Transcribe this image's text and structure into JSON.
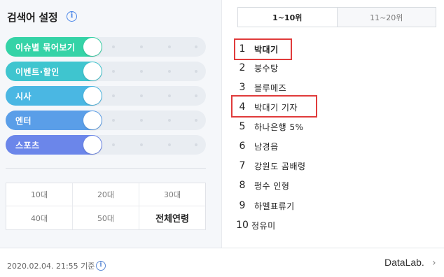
{
  "settings": {
    "title": "검색어 설정",
    "info_icon": "i"
  },
  "toggles": [
    {
      "label": "이슈별 묶어보기",
      "color": "#35d3a7"
    },
    {
      "label": "이벤트·할인",
      "color": "#3fc5cf"
    },
    {
      "label": "시사",
      "color": "#4ab7e3"
    },
    {
      "label": "엔터",
      "color": "#5a9ee8"
    },
    {
      "label": "스포츠",
      "color": "#6b86ea"
    }
  ],
  "age_filters": [
    "10대",
    "20대",
    "30대",
    "40대",
    "50대",
    "전체연령"
  ],
  "selected_age": "전체연령",
  "tabs": [
    {
      "label": "1~10위",
      "active": true
    },
    {
      "label": "11~20위",
      "active": false
    }
  ],
  "rankings": [
    {
      "rank": "1",
      "keyword": "박대기",
      "bold": true,
      "highlighted": true
    },
    {
      "rank": "2",
      "keyword": "붕수탕"
    },
    {
      "rank": "3",
      "keyword": "블루메즈"
    },
    {
      "rank": "4",
      "keyword": "박대기 기자",
      "highlighted": true
    },
    {
      "rank": "5",
      "keyword": "하나은행 5%"
    },
    {
      "rank": "6",
      "keyword": "남경읍"
    },
    {
      "rank": "7",
      "keyword": "강원도 곰배령"
    },
    {
      "rank": "8",
      "keyword": "펑수 인형"
    },
    {
      "rank": "9",
      "keyword": "하멜표류기"
    },
    {
      "rank": "10",
      "keyword": "정유미"
    }
  ],
  "footer": {
    "timestamp": "2020.02.04. 21:55 기준",
    "info_icon": "i",
    "datalab": "DataLab.",
    "chevron": "›"
  },
  "colors": {
    "highlight_border": "#e03b3b",
    "info_blue": "#4a86e8"
  }
}
